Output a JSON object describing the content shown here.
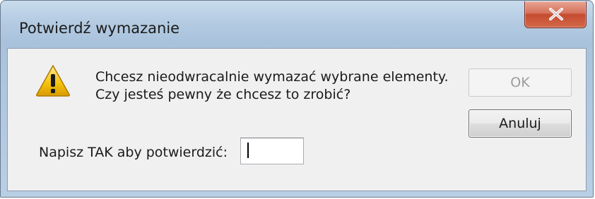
{
  "window": {
    "title": "Potwierdź wymazanie",
    "close_icon": "close-x-icon"
  },
  "message": {
    "icon": "warning-icon",
    "line1": "Chcesz nieodwracalnie wymazać wybrane elementy.",
    "line2": "Czy jesteś pewny że chcesz to zrobić?"
  },
  "buttons": {
    "ok_label": "OK",
    "ok_enabled": false,
    "cancel_label": "Anuluj"
  },
  "confirm": {
    "label": "Napisz TAK aby potwierdzić:",
    "value": ""
  },
  "colors": {
    "close_button": "#c44a2e",
    "warning_yellow": "#f4c20d",
    "content_background": "#f0f0f0"
  }
}
